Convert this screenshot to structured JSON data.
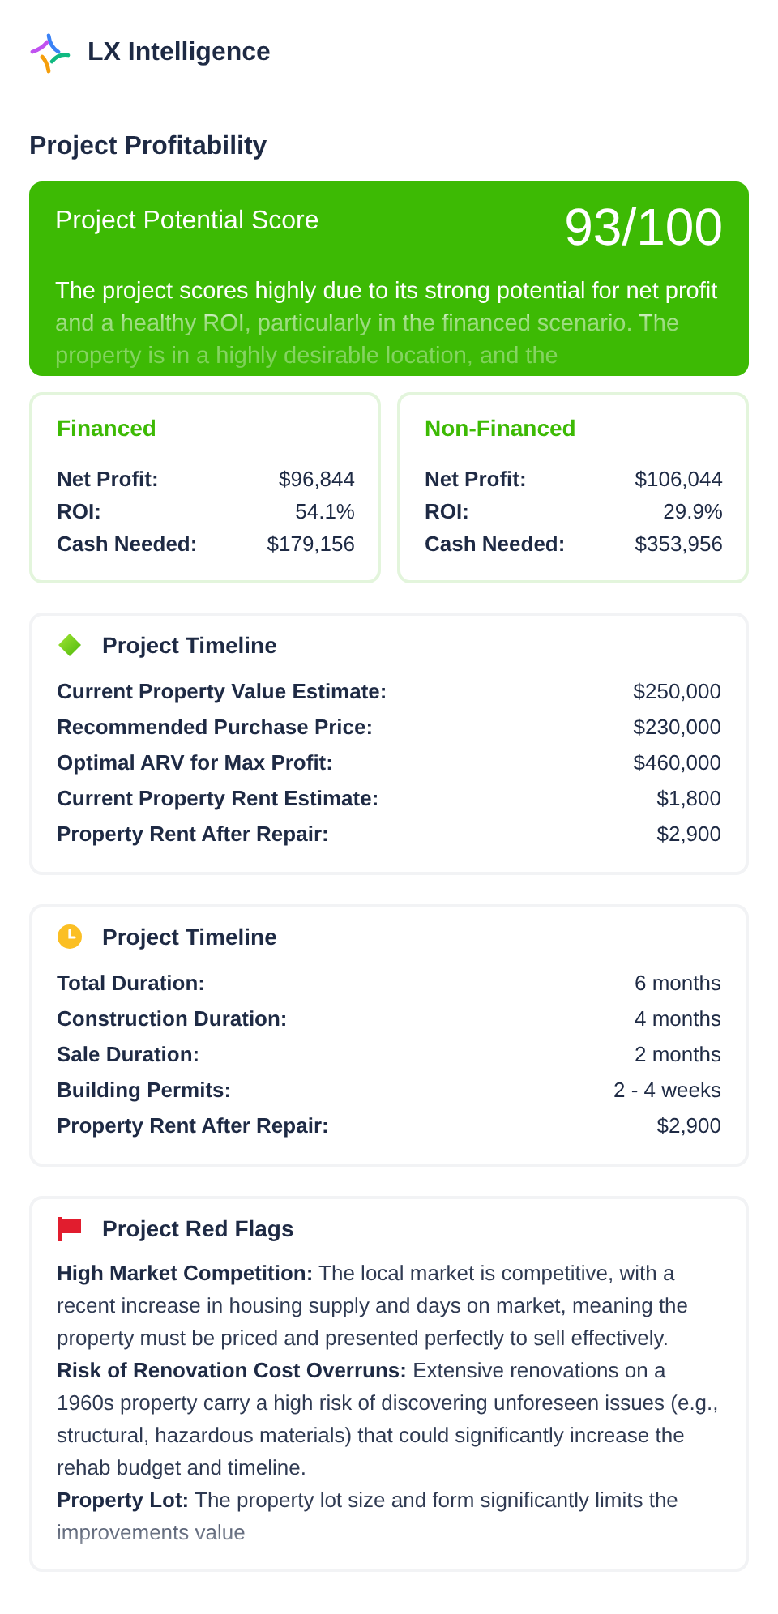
{
  "brand": {
    "name": "LX Intelligence"
  },
  "page_title": "Project Profitability",
  "score": {
    "label": "Project Potential Score",
    "value": "93/100",
    "description": "The project scores highly due to its strong potential for net profit and a healthy ROI, particularly in the financed scenario. The property is in a highly desirable location, and the"
  },
  "scenarios": [
    {
      "title": "Financed",
      "rows": [
        {
          "label": "Net Profit:",
          "value": "$96,844"
        },
        {
          "label": "ROI:",
          "value": "54.1%"
        },
        {
          "label": "Cash Needed:",
          "value": "$179,156"
        }
      ]
    },
    {
      "title": "Non-Financed",
      "rows": [
        {
          "label": "Net Profit:",
          "value": "$106,044"
        },
        {
          "label": "ROI:",
          "value": "29.9%"
        },
        {
          "label": "Cash Needed:",
          "value": "$353,956"
        }
      ]
    }
  ],
  "sections": [
    {
      "kind": "valuation",
      "title": "Project Timeline",
      "rows": [
        {
          "label": "Current Property Value Estimate:",
          "value": "$250,000"
        },
        {
          "label": "Recommended Purchase Price:",
          "value": "$230,000"
        },
        {
          "label": "Optimal ARV for Max Profit:",
          "value": "$460,000"
        },
        {
          "label": "Current Property Rent Estimate:",
          "value": "$1,800"
        },
        {
          "label": "Property Rent After Repair:",
          "value": "$2,900"
        }
      ]
    },
    {
      "kind": "schedule",
      "title": "Project Timeline",
      "rows": [
        {
          "label": "Total Duration:",
          "value": "6 months"
        },
        {
          "label": "Construction Duration:",
          "value": "4 months"
        },
        {
          "label": "Sale Duration:",
          "value": "2 months"
        },
        {
          "label": "Building Permits:",
          "value": "2 - 4 weeks"
        },
        {
          "label": "Property Rent After Repair:",
          "value": "$2,900"
        }
      ]
    },
    {
      "kind": "risks",
      "title": "Project Red Flags",
      "notes": [
        "**High Market Competition:** The local market is competitive, with a recent increase in housing supply and days on market, meaning the property must be priced and presented perfectly to sell effectively.",
        "**Risk of Renovation Cost Overruns:** Extensive renovations on a 1960s property carry a high risk of discovering unforeseen issues (e.g., structural, hazardous materials) that could significantly increase the rehab budget and timeline.",
        "**Property Lot:** The property lot size and form significantly limits the improvements value"
      ]
    }
  ]
}
